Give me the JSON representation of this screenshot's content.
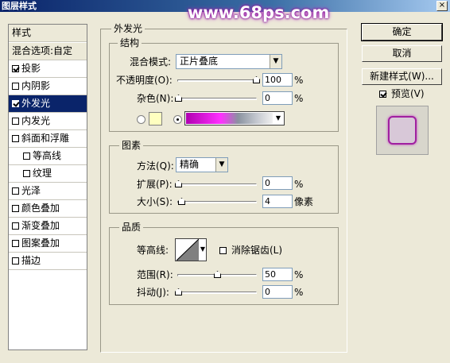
{
  "window": {
    "title": "图层样式",
    "close": "×"
  },
  "watermark": "www.68ps.com",
  "style_list": {
    "header": "样式",
    "blend_options": "混合选项:自定",
    "items": [
      {
        "label": "投影",
        "checked": true
      },
      {
        "label": "内阴影",
        "checked": false
      },
      {
        "label": "外发光",
        "checked": true
      },
      {
        "label": "内发光",
        "checked": false
      },
      {
        "label": "斜面和浮雕",
        "checked": false
      },
      {
        "label": "等高线",
        "checked": false
      },
      {
        "label": "纹理",
        "checked": false
      },
      {
        "label": "光泽",
        "checked": false
      },
      {
        "label": "颜色叠加",
        "checked": false
      },
      {
        "label": "渐变叠加",
        "checked": false
      },
      {
        "label": "图案叠加",
        "checked": false
      },
      {
        "label": "描边",
        "checked": false
      }
    ]
  },
  "outer_glow": {
    "title": "外发光",
    "structure": {
      "title": "结构",
      "blend_mode_label": "混合模式:",
      "blend_mode_value": "正片叠底",
      "opacity_label": "不透明度(O):",
      "opacity_value": "100",
      "opacity_unit": "%",
      "noise_label": "杂色(N):",
      "noise_value": "0",
      "noise_unit": "%",
      "solid_color": "#ffffc0",
      "gradient_colors": [
        "#c000c0",
        "#ff40ff",
        "#a0a8b0",
        "#f0f0f0"
      ]
    },
    "elements": {
      "title": "图素",
      "method_label": "方法(Q):",
      "method_value": "精确",
      "spread_label": "扩展(P):",
      "spread_value": "0",
      "spread_unit": "%",
      "size_label": "大小(S):",
      "size_value": "4",
      "size_unit": "像素"
    },
    "quality": {
      "title": "品质",
      "contour_label": "等高线:",
      "antialias_label": "消除锯齿(L)",
      "antialias_checked": false,
      "range_label": "范围(R):",
      "range_value": "50",
      "range_unit": "%",
      "jitter_label": "抖动(J):",
      "jitter_value": "0",
      "jitter_unit": "%"
    }
  },
  "buttons": {
    "ok": "确定",
    "cancel": "取消",
    "new_style": "新建样式(W)...",
    "preview_label": "预览(V)",
    "preview_checked": true
  },
  "preview_swatch": {
    "fill": "#d8c8d8",
    "glow": "#a020a0"
  }
}
